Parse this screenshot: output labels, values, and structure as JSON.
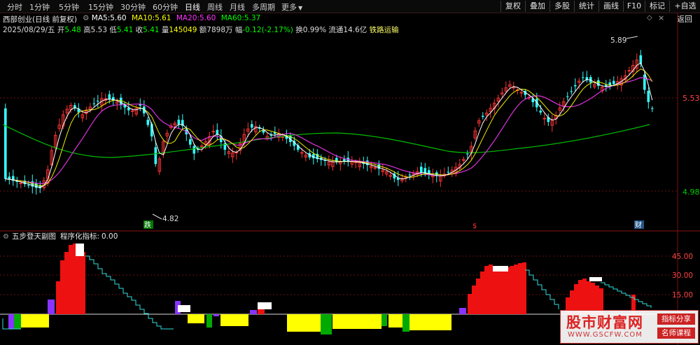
{
  "toolbar": {
    "periods": [
      {
        "label": "分时",
        "active": false
      },
      {
        "label": "1分钟",
        "active": false
      },
      {
        "label": "5分钟",
        "active": false
      },
      {
        "label": "15分钟",
        "active": false
      },
      {
        "label": "30分钟",
        "active": false
      },
      {
        "label": "60分钟",
        "active": false
      },
      {
        "label": "日线",
        "active": true
      },
      {
        "label": "周线",
        "active": false
      },
      {
        "label": "月线",
        "active": false
      },
      {
        "label": "多周期",
        "active": false
      },
      {
        "label": "更多",
        "active": false
      }
    ],
    "right_buttons": [
      "复权",
      "叠加",
      "多股",
      "统计",
      "画线",
      "F10",
      "标记",
      "+自选",
      "返回"
    ]
  },
  "main_panel": {
    "title": "西部创业(日线 前复权)",
    "ma": [
      {
        "label": "MA5:",
        "value": "5.60",
        "color": "#ffffff"
      },
      {
        "label": "MA10:",
        "value": "5.61",
        "color": "#ffff00"
      },
      {
        "label": "MA20:",
        "value": "5.60",
        "color": "#ff33ff"
      },
      {
        "label": "MA60:",
        "value": "5.37",
        "color": "#00ff00"
      }
    ],
    "quote": {
      "date": "2025/08/29/五",
      "open_label": "开",
      "open": "5.48",
      "high_label": "高",
      "high": "5.53",
      "low_label": "低",
      "low": "5.41",
      "close_label": "收",
      "close": "5.41",
      "volume_label": "量",
      "volume": "145049",
      "amount_label": "额",
      "amount": "7898万",
      "change_label": "幅",
      "change": "-0.12(-2.17%)",
      "turnover_label": "换",
      "turnover": "0.99%",
      "float_label": "流通",
      "float": "14.6亿",
      "industry": "铁路运输"
    },
    "price_labels": [
      "5.53",
      "4.98"
    ],
    "high_marker": "5.89",
    "low_marker": "4.82",
    "tags": [
      "跌",
      "$",
      "财"
    ]
  },
  "sub_panel": {
    "title": "五步登天副图",
    "indicator": "程序化指标:",
    "indicator_value": "0.00",
    "axis_labels": [
      "45.00",
      "30.00",
      "15.00"
    ]
  },
  "watermark": {
    "title": "股市财富网",
    "url": "WWW.GSCFW.COM",
    "tag1": "指标分享",
    "tag2": "名师课程"
  },
  "colors": {
    "up": "#ff3333",
    "down": "#33ffff",
    "ma5": "#ffffff",
    "ma10": "#ffff00",
    "ma20": "#ff33ff",
    "ma60": "#00cc00",
    "grid": "#7a1010"
  }
}
